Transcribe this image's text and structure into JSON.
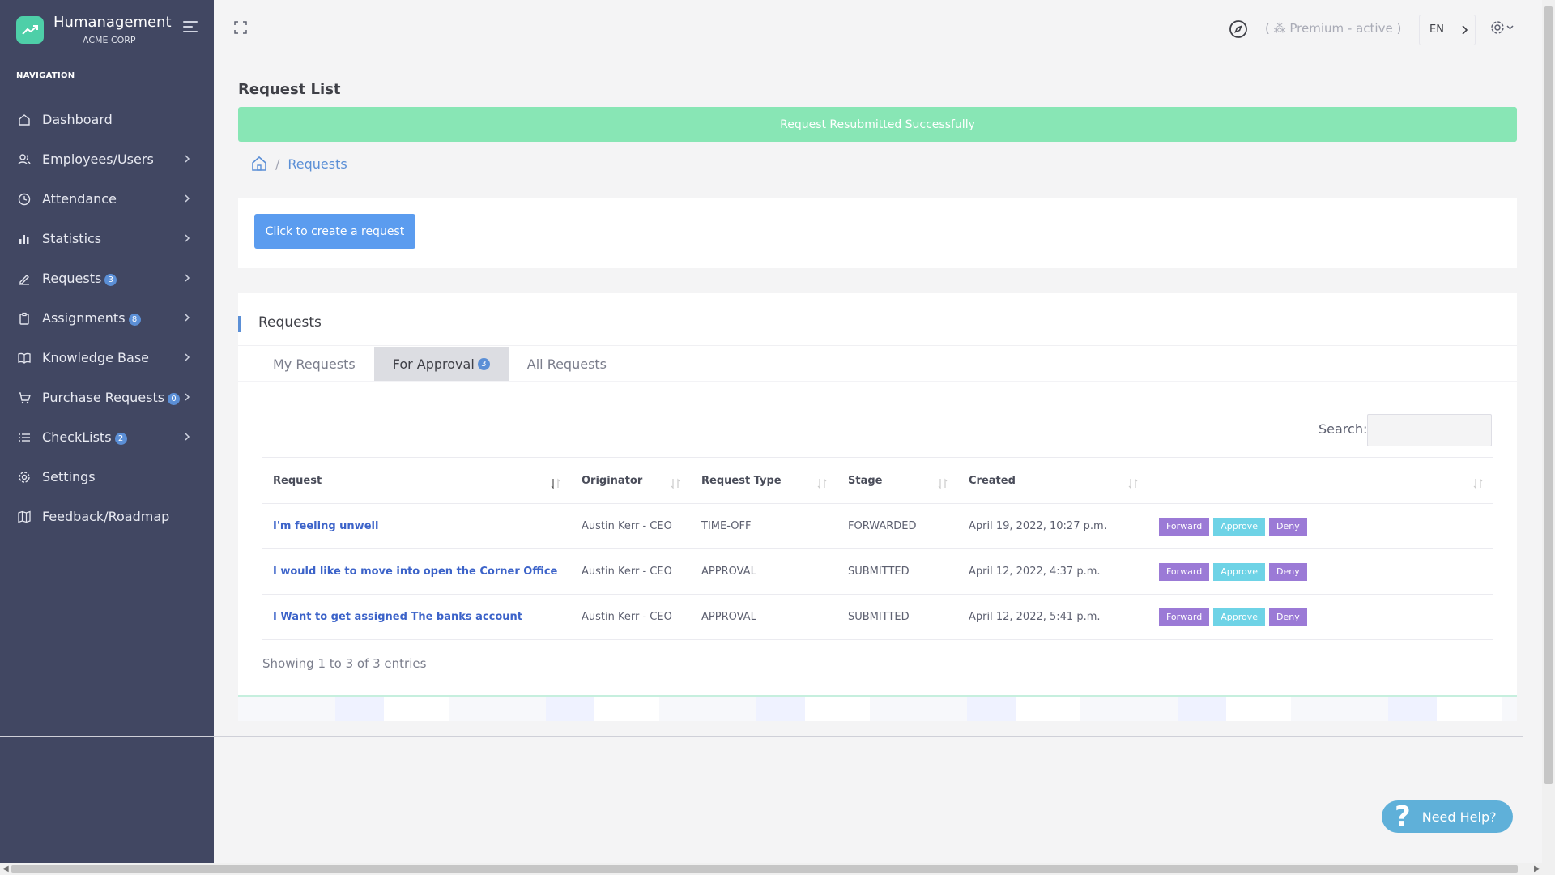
{
  "app": {
    "name": "Humanagement",
    "org": "ACME CORP",
    "accent_color": "#4ecfa8",
    "sidebar_bg": "#414762"
  },
  "sidebar": {
    "heading": "NAVIGATION",
    "items": [
      {
        "label": "Dashboard",
        "icon": "home-icon",
        "badge": "",
        "chevron": false
      },
      {
        "label": "Employees/Users",
        "icon": "users-icon",
        "badge": "",
        "chevron": true
      },
      {
        "label": "Attendance",
        "icon": "clock-icon",
        "badge": "",
        "chevron": true
      },
      {
        "label": "Statistics",
        "icon": "bar-chart-icon",
        "badge": "",
        "chevron": true
      },
      {
        "label": "Requests",
        "icon": "edit-icon",
        "badge": "3",
        "chevron": true
      },
      {
        "label": "Assignments",
        "icon": "clipboard-icon",
        "badge": "8",
        "chevron": true
      },
      {
        "label": "Knowledge Base",
        "icon": "book-icon",
        "badge": "",
        "chevron": true
      },
      {
        "label": "Purchase Requests",
        "icon": "cart-icon",
        "badge": "0",
        "chevron": true
      },
      {
        "label": "CheckLists",
        "icon": "list-icon",
        "badge": "2",
        "chevron": true
      },
      {
        "label": "Settings",
        "icon": "gear-icon",
        "badge": "",
        "chevron": false
      },
      {
        "label": "Feedback/Roadmap",
        "icon": "map-icon",
        "badge": "",
        "chevron": false
      }
    ]
  },
  "header": {
    "premium_text": "( ⁂ Premium - active )",
    "language": "EN"
  },
  "page": {
    "title": "Request List",
    "alert": "Request Resubmitted Successfully",
    "breadcrumb": "Requests",
    "create_button": "Click to create a request"
  },
  "requests_card": {
    "title": "Requests",
    "tabs": [
      {
        "label": "My Requests",
        "badge": "",
        "active": false
      },
      {
        "label": "For Approval",
        "badge": "3",
        "active": true
      },
      {
        "label": "All Requests",
        "badge": "",
        "active": false
      }
    ],
    "search_label": "Search:",
    "search_value": "",
    "columns": [
      "Request",
      "Originator",
      "Request Type",
      "Stage",
      "Created",
      ""
    ],
    "rows": [
      {
        "request": "I'm feeling unwell",
        "originator": "Austin Kerr - CEO",
        "type": "TIME-OFF",
        "stage": "FORWARDED",
        "created": "April 19, 2022, 10:27 p.m."
      },
      {
        "request": "I would like to move into open the Corner Office",
        "originator": "Austin Kerr - CEO",
        "type": "APPROVAL",
        "stage": "SUBMITTED",
        "created": "April 12, 2022, 4:37 p.m."
      },
      {
        "request": "I Want to get assigned The banks account",
        "originator": "Austin Kerr - CEO",
        "type": "APPROVAL",
        "stage": "SUBMITTED",
        "created": "April 12, 2022, 5:41 p.m."
      }
    ],
    "actions": {
      "forward": "Forward",
      "approve": "Approve",
      "deny": "Deny"
    },
    "showing": "Showing 1 to 3 of 3 entries"
  },
  "help": {
    "label": "Need Help?"
  }
}
